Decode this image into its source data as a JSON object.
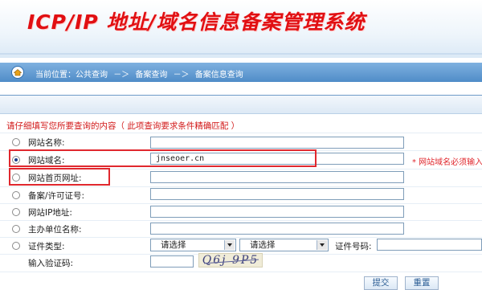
{
  "header": {
    "system_title": "ICP/IP 地址/域名信息备案管理系统"
  },
  "breadcrumb": {
    "location_label": "当前位置：公共查询",
    "sep1": "－＞",
    "item2": "备案查询",
    "sep2": "－＞",
    "item3": "备案信息查询"
  },
  "form": {
    "notice": "请仔细填写您所要查询的内容（ 此项查询要求条件精确匹配 ）",
    "fields": [
      {
        "label": "网站名称:",
        "value": "",
        "selected": false
      },
      {
        "label": "网站域名:",
        "value": "jnseoer.cn",
        "selected": true
      },
      {
        "label": "网站首页网址:",
        "value": "",
        "selected": false
      },
      {
        "label": "备案/许可证号:",
        "value": "",
        "selected": false
      },
      {
        "label": "网站IP地址:",
        "value": "",
        "selected": false
      },
      {
        "label": "主办单位名称:",
        "value": "",
        "selected": false
      },
      {
        "label": "证件类型:",
        "value": "",
        "selected": false
      }
    ],
    "domain_hint": "* 网站域名必须输入",
    "cert_type_select_1": "请选择",
    "cert_type_select_2": "请选择",
    "cert_no_label": "证件号码:",
    "captcha_label": "输入验证码:",
    "captcha_text": "Q6j 9P5",
    "submit_label": "提交",
    "reset_label": "重置"
  },
  "colors": {
    "title_red": "#e10f12",
    "crumb_blue": "#4f8cc8",
    "highlight_red": "#e0282e"
  }
}
